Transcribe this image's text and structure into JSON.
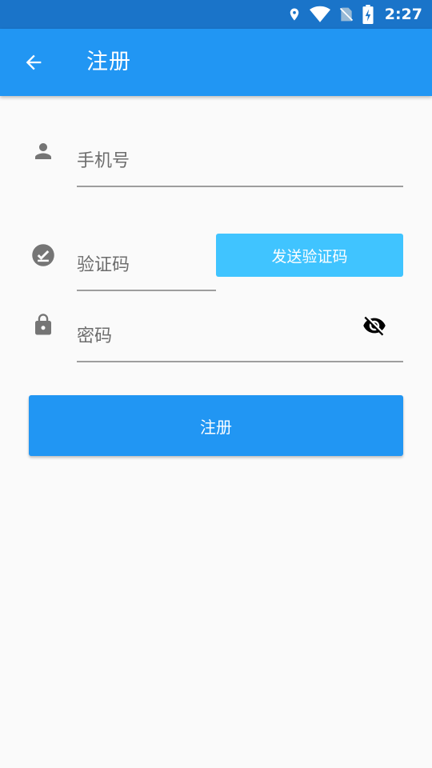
{
  "status_bar": {
    "time": "2:27",
    "icons": [
      "location-icon",
      "wifi-icon",
      "no-sim-icon",
      "battery-charging-icon"
    ]
  },
  "app_bar": {
    "title": "注册",
    "back_icon": "arrow-left-icon"
  },
  "form": {
    "phone": {
      "placeholder": "手机号",
      "value": "",
      "icon": "person-icon"
    },
    "code": {
      "placeholder": "验证码",
      "value": "",
      "icon": "check-circle-icon"
    },
    "send_code_label": "发送验证码",
    "password": {
      "placeholder": "密码",
      "value": "",
      "icon": "lock-icon",
      "toggle_icon": "eye-off-icon"
    },
    "submit_label": "注册"
  },
  "colors": {
    "primary": "#2196f3",
    "status_bar": "#1a74c9",
    "accent": "#40c4ff",
    "background": "#fafafa",
    "icon_grey": "#757575"
  }
}
